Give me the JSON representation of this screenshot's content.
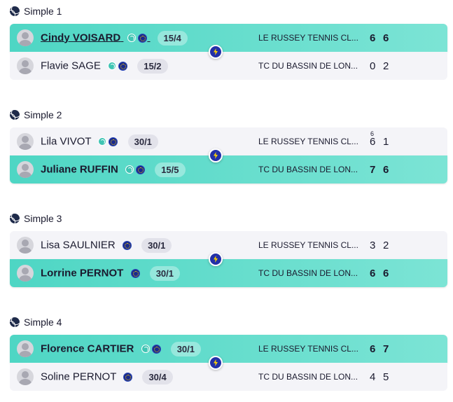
{
  "matches": [
    {
      "title": "Simple 1",
      "players": [
        {
          "name": "Cindy VOISARD",
          "rank": "15/4",
          "club": "LE RUSSEY TENNIS CL...",
          "scores": [
            "6",
            "6"
          ],
          "tiebreaks": [
            "",
            ""
          ],
          "winner": true
        },
        {
          "name": "Flavie SAGE",
          "rank": "15/2",
          "club": "TC DU BASSIN DE LON...",
          "scores": [
            "0",
            "2"
          ],
          "tiebreaks": [
            "",
            ""
          ],
          "winner": false
        }
      ]
    },
    {
      "title": "Simple 2",
      "players": [
        {
          "name": "Lila VIVOT",
          "rank": "30/1",
          "club": "LE RUSSEY TENNIS CL...",
          "scores": [
            "6",
            "1"
          ],
          "tiebreaks": [
            "6",
            ""
          ],
          "winner": false
        },
        {
          "name": "Juliane RUFFIN",
          "rank": "15/5",
          "club": "TC DU BASSIN DE LON...",
          "scores": [
            "7",
            "6"
          ],
          "tiebreaks": [
            "",
            ""
          ],
          "winner": true
        }
      ]
    },
    {
      "title": "Simple 3",
      "players": [
        {
          "name": "Lisa SAULNIER",
          "rank": "30/1",
          "club": "LE RUSSEY TENNIS CL...",
          "scores": [
            "3",
            "2"
          ],
          "tiebreaks": [
            "",
            ""
          ],
          "winner": false
        },
        {
          "name": "Lorrine PERNOT",
          "rank": "30/1",
          "club": "TC DU BASSIN DE LON...",
          "scores": [
            "6",
            "6"
          ],
          "tiebreaks": [
            "",
            ""
          ],
          "winner": true
        }
      ]
    },
    {
      "title": "Simple 4",
      "players": [
        {
          "name": "Florence CARTIER",
          "rank": "30/1",
          "club": "LE RUSSEY TENNIS CL...",
          "scores": [
            "6",
            "7"
          ],
          "tiebreaks": [
            "",
            ""
          ],
          "winner": true
        },
        {
          "name": "Soline PERNOT",
          "rank": "30/4",
          "club": "TC DU BASSIN DE LON...",
          "scores": [
            "4",
            "5"
          ],
          "tiebreaks": [
            "",
            ""
          ],
          "winner": false
        }
      ]
    }
  ],
  "colors": {
    "winner_bg": "#4ed6c4",
    "loser_bg": "#f4f4f8",
    "bolt_bg": "#2330a8",
    "bolt_glyph": "#ffd200"
  },
  "icons": {
    "match_title": "tennis-ball-icon",
    "tag_1": "tennis-ball-icon",
    "tag_2": "federation-badge-icon",
    "vs": "lightning-bolt-icon",
    "player": "avatar-placeholder-icon"
  }
}
